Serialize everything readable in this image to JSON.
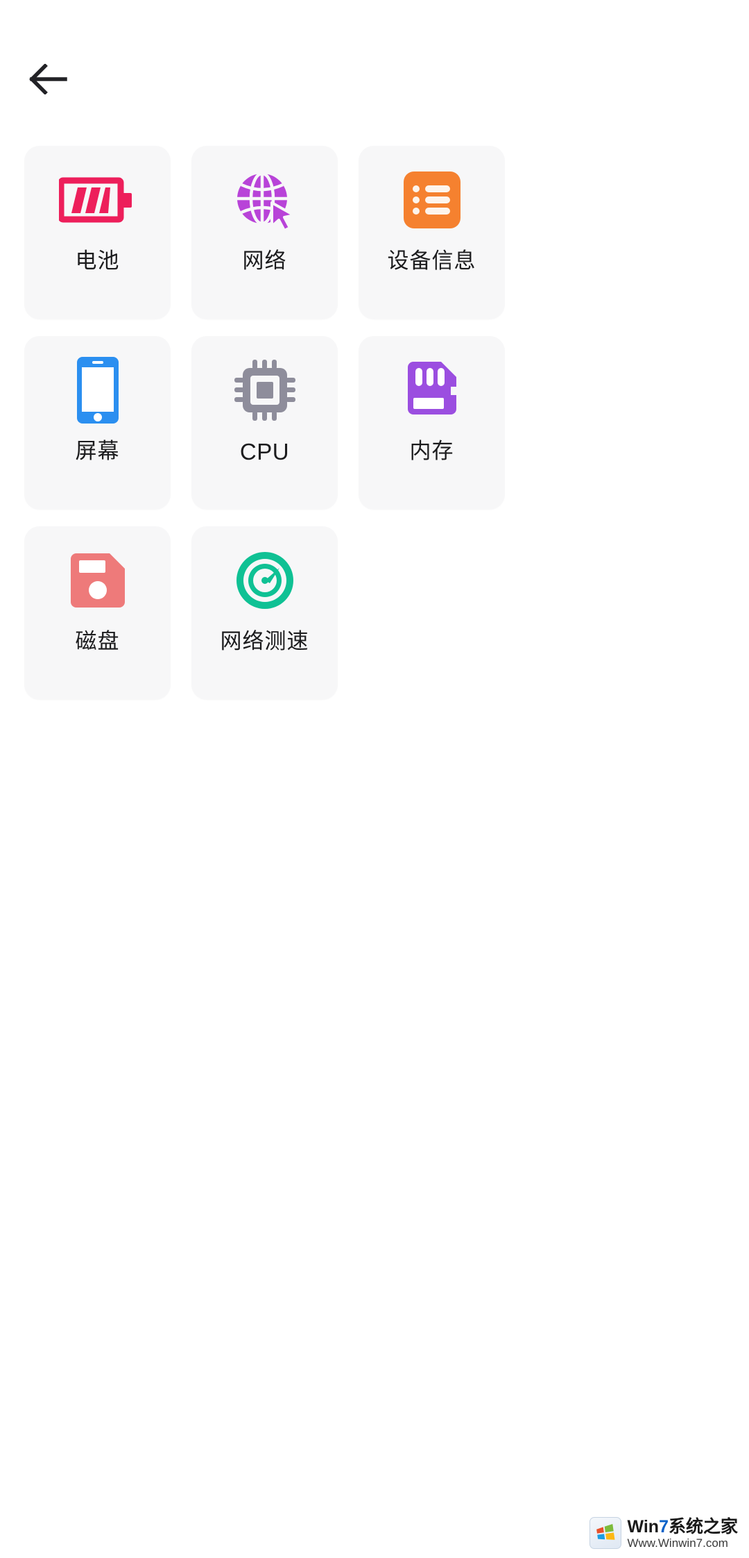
{
  "header": {
    "back_icon": "arrow-left-icon"
  },
  "grid": {
    "items": [
      {
        "id": "battery",
        "label": "电池",
        "icon": "battery-icon",
        "color": "#ED1F5B",
        "latin": false
      },
      {
        "id": "network",
        "label": "网络",
        "icon": "globe-cursor-icon",
        "color": "#B843D8",
        "latin": false
      },
      {
        "id": "deviceinfo",
        "label": "设备信息",
        "icon": "list-card-icon",
        "color": "#F5812F",
        "latin": false
      },
      {
        "id": "screen",
        "label": "屏幕",
        "icon": "smartphone-icon",
        "color": "#2B8FF0",
        "latin": false
      },
      {
        "id": "cpu",
        "label": "CPU",
        "icon": "cpu-chip-icon",
        "color": "#8E8D9B",
        "latin": true
      },
      {
        "id": "memory",
        "label": "内存",
        "icon": "sd-card-icon",
        "color": "#9B4EE0",
        "latin": false
      },
      {
        "id": "disk",
        "label": "磁盘",
        "icon": "floppy-disk-icon",
        "color": "#EE7A7A",
        "latin": false
      },
      {
        "id": "speedtest",
        "label": "网络测速",
        "icon": "speedometer-icon",
        "color": "#0FC194",
        "latin": false
      }
    ]
  },
  "watermark": {
    "title_prefix": "Win",
    "title_accent": "7",
    "title_suffix": "系统之家",
    "subtitle": "Www.Winwin7.com",
    "badge_icon": "windows-flag-icon"
  }
}
